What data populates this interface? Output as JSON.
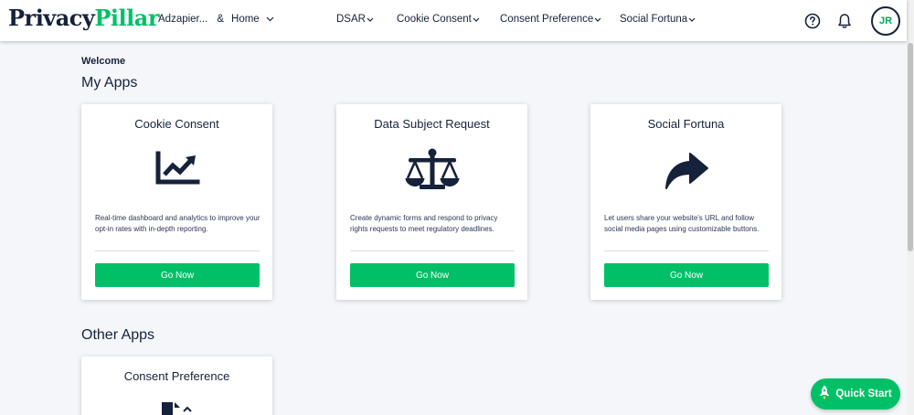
{
  "header": {
    "logo_part1": "Privacy",
    "logo_part2": "Pillar",
    "workspace": "Adzapier...",
    "workspace_sep": "&",
    "workspace_page": "Home",
    "nav": [
      {
        "label": "DSAR"
      },
      {
        "label": "Cookie Consent"
      },
      {
        "label": "Consent Preference"
      },
      {
        "label": "Social Fortuna"
      }
    ],
    "avatar_initials": "JR"
  },
  "welcome": "Welcome",
  "my_apps_title": "My Apps",
  "other_apps_title": "Other Apps",
  "my_apps": [
    {
      "title": "Cookie Consent",
      "icon": "chart-line-icon",
      "desc": "Real-time dashboard and analytics to improve your opt-in rates with in-depth reporting.",
      "button": "Go Now"
    },
    {
      "title": "Data Subject Request",
      "icon": "balance-scale-icon",
      "desc": "Create dynamic forms and respond to privacy rights requests to meet regulatory deadlines.",
      "button": "Go Now"
    },
    {
      "title": "Social Fortuna",
      "icon": "share-arrow-icon",
      "desc": "Let users share your website's URL and follow social media pages using customizable buttons.",
      "button": "Go Now"
    }
  ],
  "other_apps": [
    {
      "title": "Consent Preference",
      "icon": "file-signature-icon"
    }
  ],
  "quick_start": "Quick Start",
  "colors": {
    "accent": "#00c067",
    "text": "#16213a",
    "background": "#f4f6fa"
  }
}
